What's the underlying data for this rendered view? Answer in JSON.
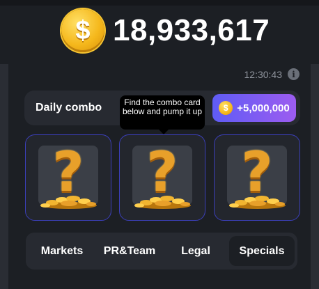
{
  "balance": {
    "value": "18,933,617",
    "coin_symbol": "$"
  },
  "timer": {
    "time": "12:30:43",
    "info_symbol": "i"
  },
  "combo": {
    "title": "Daily combo",
    "reward": "+5,000,000",
    "tooltip": "Find the combo card below and pump it up"
  },
  "cards": [
    {
      "symbol": "?",
      "state": "hidden"
    },
    {
      "symbol": "?",
      "state": "hidden"
    },
    {
      "symbol": "?",
      "state": "hidden"
    }
  ],
  "tabs": [
    {
      "label": "Markets",
      "active": false
    },
    {
      "label": "PR&Team",
      "active": false
    },
    {
      "label": "Legal",
      "active": false
    },
    {
      "label": "Specials",
      "active": true
    }
  ],
  "colors": {
    "background": "#1c1f24",
    "panel": "#272a31",
    "accent_start": "#5f5cf5",
    "accent_end": "#9c5cf0",
    "card_border": "#3b3fb8",
    "gold": "#f5b81c"
  }
}
